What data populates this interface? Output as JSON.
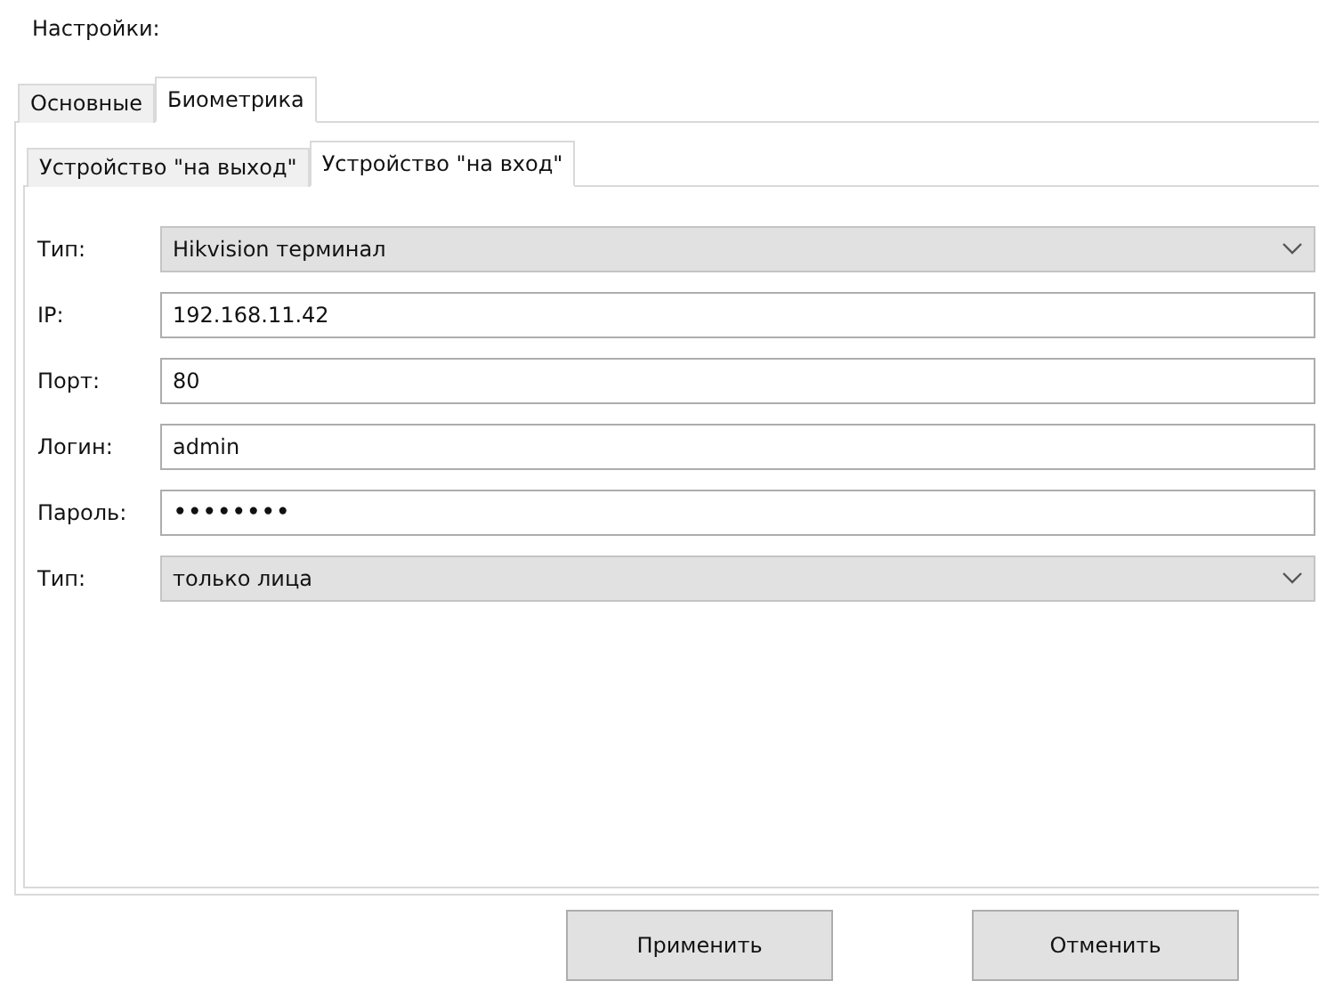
{
  "title": "Настройки:",
  "tabs": [
    {
      "label": "Основные",
      "selected": false
    },
    {
      "label": "Биометрика",
      "selected": true
    }
  ],
  "subtabs": [
    {
      "label": "Устройство \"на выход\"",
      "selected": false
    },
    {
      "label": "Устройство \"на вход\"",
      "selected": true
    }
  ],
  "fields": [
    {
      "label": "Тип:",
      "kind": "combo",
      "value": "Hikvision терминал"
    },
    {
      "label": "IP:",
      "kind": "text",
      "value": "192.168.11.42"
    },
    {
      "label": "Порт:",
      "kind": "text",
      "value": "80"
    },
    {
      "label": "Логин:",
      "kind": "text",
      "value": "admin"
    },
    {
      "label": "Пароль:",
      "kind": "password",
      "value": "••••••••"
    },
    {
      "label": "Тип:",
      "kind": "combo",
      "value": "только лица"
    }
  ],
  "buttons": [
    "Применить",
    "Отменить"
  ]
}
